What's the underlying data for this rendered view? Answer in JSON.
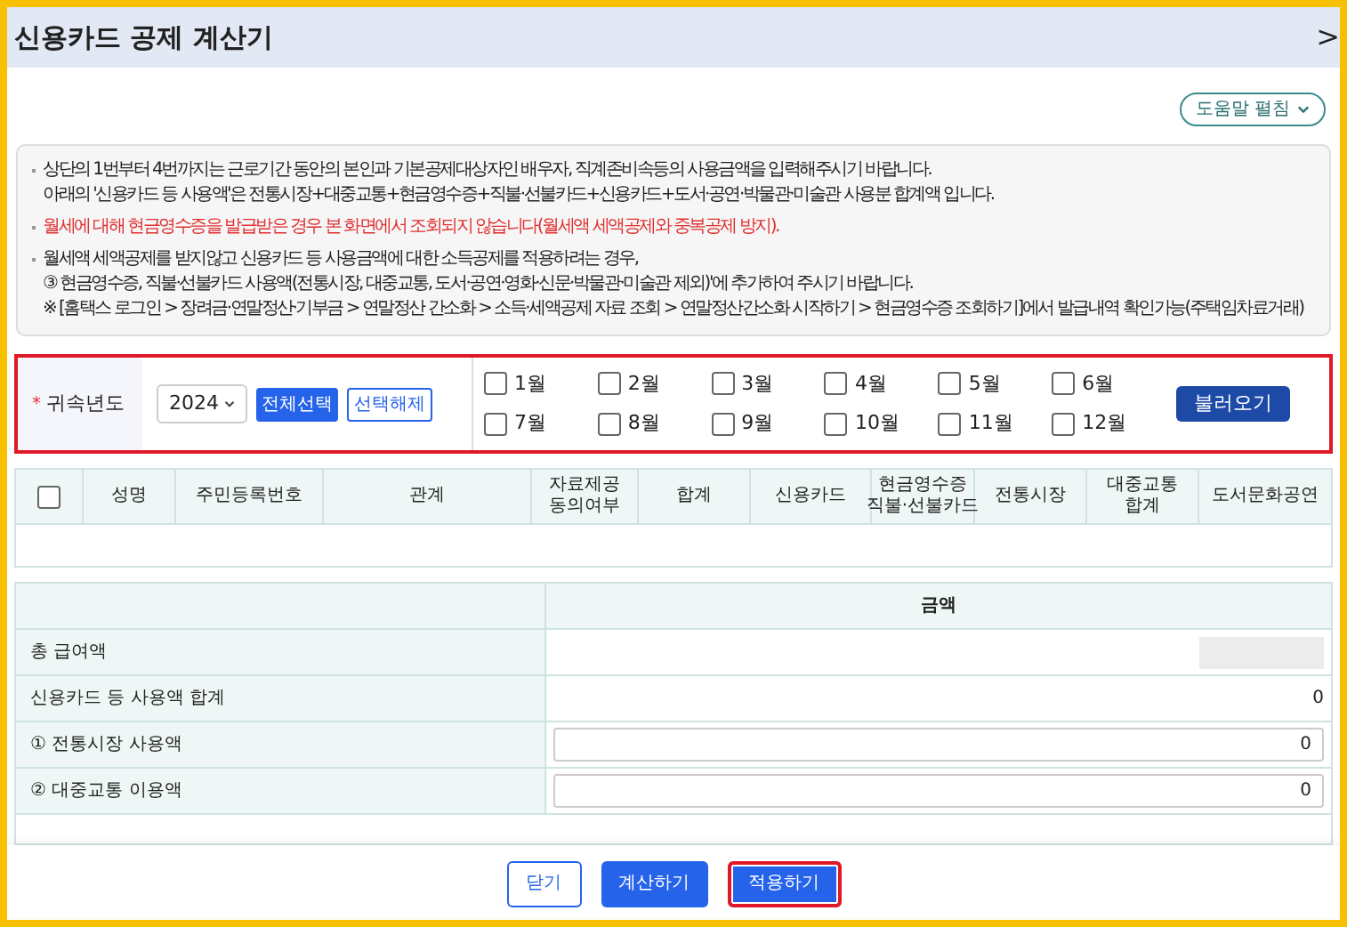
{
  "window": {
    "title": "신용카드 공제 계산기",
    "close": ">"
  },
  "help_button": {
    "label": "도움말 펼침"
  },
  "notices": [
    {
      "kind": "normal",
      "lines": [
        "상단의 1번부터 4번까지는 근로기간 동안의 본인과 기본공제대상자인 배우자, 직계존비속등의 사용금액을 입력해주시기 바랍니다.",
        "아래의 '신용카드 등 사용액'은 전통시장+대중교통+현금영수증+직불·선불카드+신용카드+도서·공연·박물관·미술관 사용분 합계액 입니다."
      ]
    },
    {
      "kind": "warning",
      "lines": [
        "월세에 대해 현금영수증을 발급받은 경우 본 화면에서 조회되지 않습니다(월세액 세액공제와 중복공제 방지)."
      ]
    },
    {
      "kind": "normal",
      "lines": [
        "월세액 세액공제를 받지않고 신용카드 등 사용금액에 대한 소득공제를 적용하려는 경우,",
        "③ 현금영수증, 직불·선불카드 사용액(전통시장, 대중교통, 도서·공연·영화·신문·박물관·미술관 제외)'에 추가하여 주시기 바랍니다.",
        "※ [홈택스 로그인 > 장려금·연말정산·기부금 > 연말정산 간소화 > 소득·세액공제 자료 조회 > 연말정산간소화 시작하기 > 현금영수증 조회하기]에서 발급내역 확인가능(주택임차료거래)"
      ]
    }
  ],
  "filter": {
    "required_mark": "*",
    "label": "귀속년도",
    "year": "2024",
    "select_all": "전체선택",
    "deselect": "선택해제",
    "load_button": "불러오기",
    "months": [
      {
        "label": "1월",
        "checked": false
      },
      {
        "label": "2월",
        "checked": false
      },
      {
        "label": "3월",
        "checked": false
      },
      {
        "label": "4월",
        "checked": false
      },
      {
        "label": "5월",
        "checked": false
      },
      {
        "label": "6월",
        "checked": false
      },
      {
        "label": "7월",
        "checked": false
      },
      {
        "label": "8월",
        "checked": false
      },
      {
        "label": "9월",
        "checked": false
      },
      {
        "label": "10월",
        "checked": false
      },
      {
        "label": "11월",
        "checked": false
      },
      {
        "label": "12월",
        "checked": false
      }
    ]
  },
  "people_table": {
    "select_all_checked": false,
    "columns": [
      "성명",
      "주민등록번호",
      "관계",
      "자료제공\n동의여부",
      "합계",
      "신용카드",
      "현금영수증\n직불·선불카드",
      "전통시장",
      "대중교통\n합계",
      "도서문화공연"
    ]
  },
  "amount_table": {
    "header": "금액",
    "rows": [
      {
        "kind": "redacted",
        "label": "총 급여액"
      },
      {
        "kind": "text",
        "label": "신용카드 등 사용액 합계",
        "value": "0"
      },
      {
        "kind": "input",
        "label": "① 전통시장 사용액",
        "value": "0"
      },
      {
        "kind": "input",
        "label": "② 대중교통 이용액",
        "value": "0"
      }
    ]
  },
  "footer_buttons": [
    {
      "label": "닫기",
      "kind": "outline",
      "highlighted": false
    },
    {
      "label": "계산하기",
      "kind": "primary",
      "highlighted": false
    },
    {
      "label": "적용하기",
      "kind": "primary",
      "highlighted": true
    }
  ]
}
